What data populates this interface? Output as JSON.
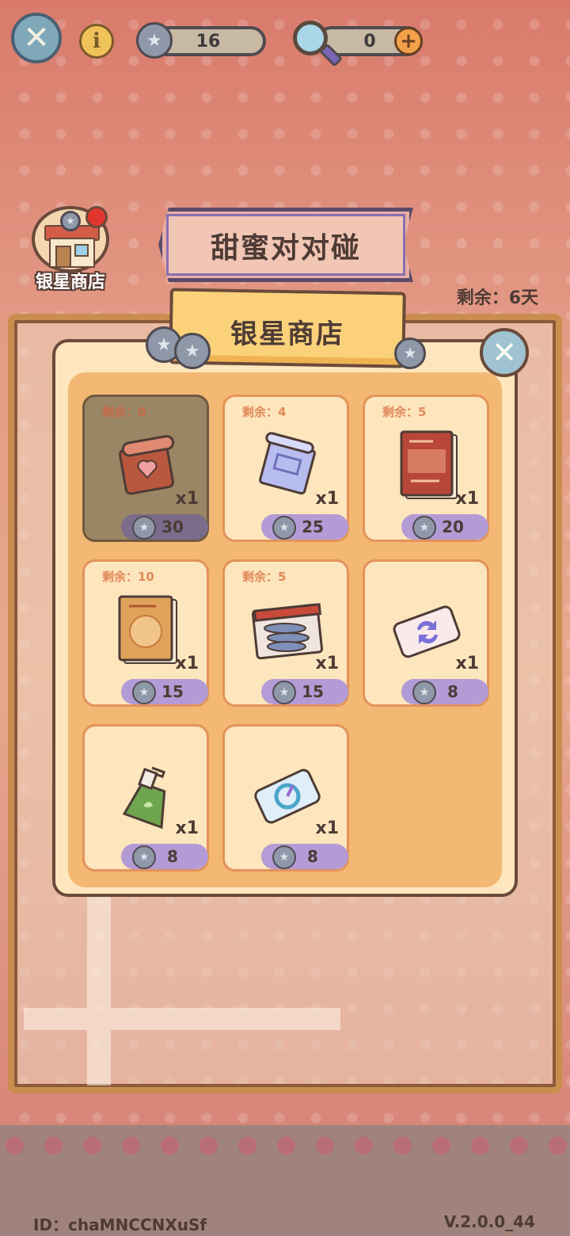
{
  "top_bar": {
    "star_count": "16",
    "magnifier_count": "0",
    "icons": {
      "close": "close-icon",
      "info": "info-icon",
      "star": "silver-star-coin-icon",
      "magnifier": "magnifier-icon",
      "plus": "plus-icon"
    }
  },
  "side": {
    "shop_label": "银星商店"
  },
  "event": {
    "title": "甜蜜对对碰",
    "remaining": "剩余：6天"
  },
  "shop": {
    "title": "银星商店",
    "items": [
      {
        "stock": "剩余：0",
        "qty": "x1",
        "price": "30",
        "icon": "heart-scroll-icon",
        "sold_out": true
      },
      {
        "stock": "剩余：4",
        "qty": "x1",
        "price": "25",
        "icon": "blueprint-scroll-icon",
        "sold_out": false
      },
      {
        "stock": "剩余：5",
        "qty": "x1",
        "price": "20",
        "icon": "red-recipe-book-icon",
        "sold_out": false
      },
      {
        "stock": "剩余：10",
        "qty": "x1",
        "price": "15",
        "icon": "orange-recipe-book-icon",
        "sold_out": false
      },
      {
        "stock": "剩余：5",
        "qty": "x1",
        "price": "15",
        "icon": "sardine-tray-icon",
        "sold_out": false
      },
      {
        "stock": "",
        "qty": "x1",
        "price": "8",
        "icon": "shuffle-card-icon",
        "sold_out": false
      },
      {
        "stock": "",
        "qty": "x1",
        "price": "8",
        "icon": "spray-bottle-icon",
        "sold_out": false
      },
      {
        "stock": "",
        "qty": "x1",
        "price": "8",
        "icon": "target-card-icon",
        "sold_out": false
      }
    ]
  },
  "footer": {
    "id_text": "ID：chaMNCCNXuSf",
    "version": "V.2.0.0_44"
  },
  "colors": {
    "panel": "#fde6bd",
    "panel_inner": "#f3b873",
    "price_pill": "#b39bd6",
    "frame": "#c98d4e"
  }
}
